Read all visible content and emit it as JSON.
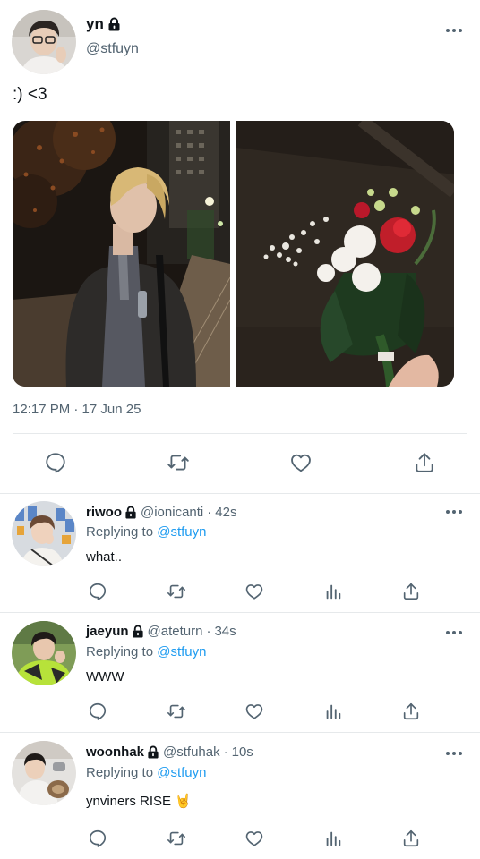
{
  "main_tweet": {
    "display_name": "yn",
    "handle": "@stfuyn",
    "text": ":) <3",
    "timestamp": "12:17 PM · 17 Jun 25",
    "images": [
      "night-street-portrait-photo",
      "flower-bouquet-photo"
    ],
    "protected": true
  },
  "replies": [
    {
      "display_name": "riwoo",
      "handle": "@ionicanti",
      "time": "42s",
      "replying_label": "Replying to",
      "replying_to": "@stfuyn",
      "text": "what.."
    },
    {
      "display_name": "jaeyun",
      "handle": "@ateturn",
      "time": "34s",
      "replying_label": "Replying to",
      "replying_to": "@stfuyn",
      "text": "WWW"
    },
    {
      "display_name": "woonhak",
      "handle": "@stfuhak",
      "time": "10s",
      "replying_label": "Replying to",
      "replying_to": "@stfuyn",
      "text": "ynviners RISE 🤘"
    }
  ],
  "separator": "·",
  "icons": {
    "reply": "reply-icon",
    "retweet": "retweet-icon",
    "like": "like-icon",
    "stats": "stats-icon",
    "share": "share-icon",
    "lock": "lock-icon",
    "more": "more-icon"
  },
  "colors": {
    "text": "#0f1419",
    "secondary": "#536471",
    "mention": "#1d9bf0",
    "divider": "#e6e9eb"
  }
}
